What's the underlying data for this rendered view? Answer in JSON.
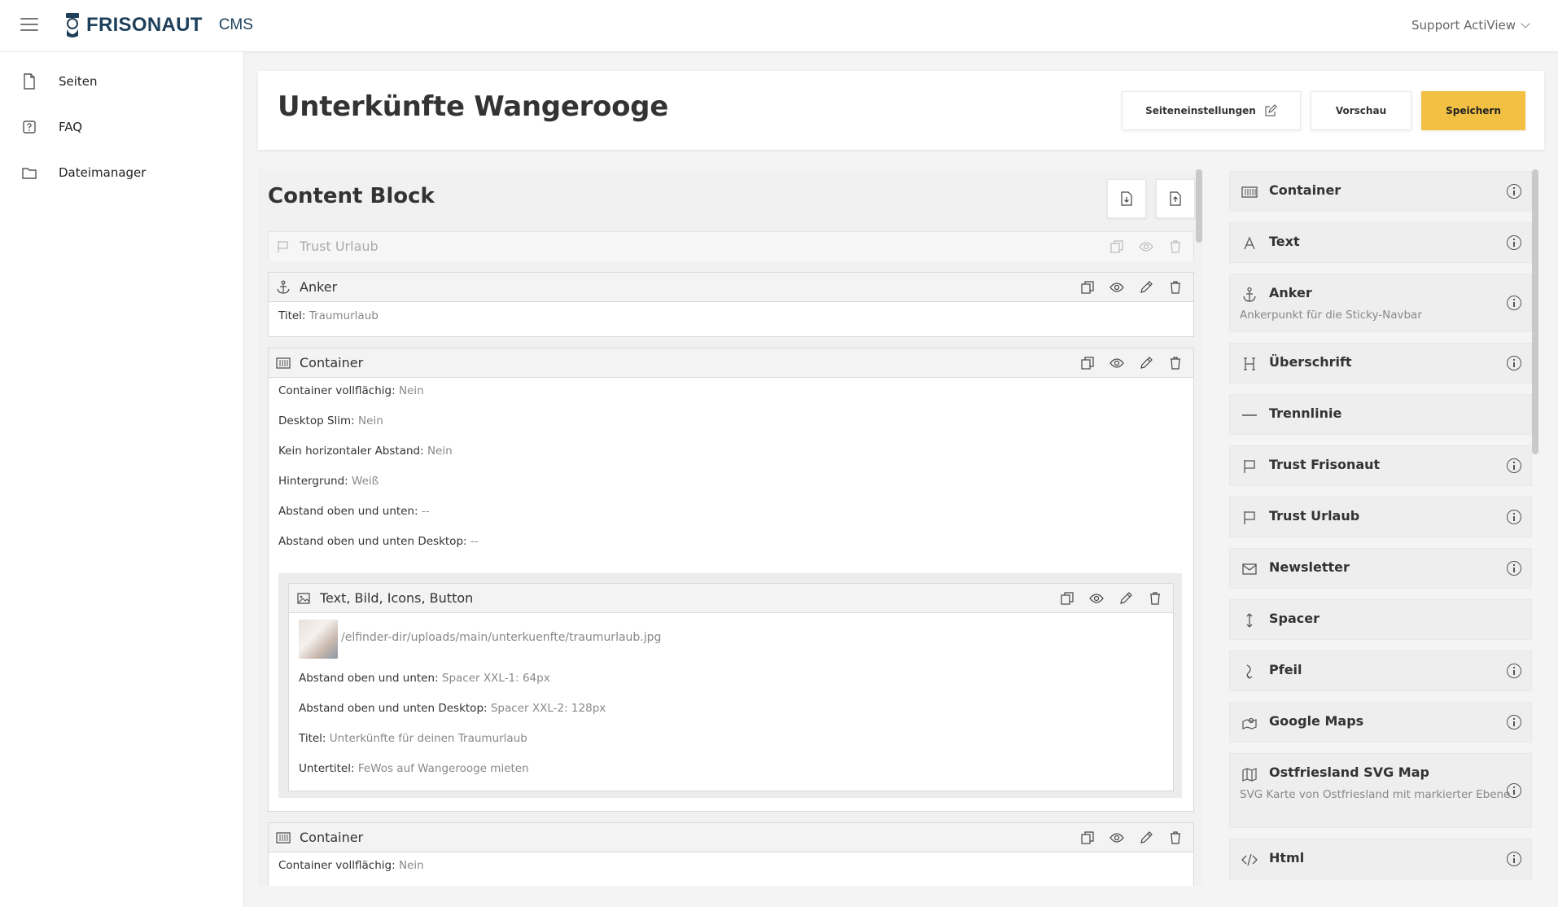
{
  "app": {
    "brand": "FRISONAUT",
    "product": "CMS",
    "user_menu": "Support ActiView"
  },
  "sidebar": {
    "items": [
      {
        "label": "Seiten",
        "icon": "file-icon"
      },
      {
        "label": "FAQ",
        "icon": "help-square-icon"
      },
      {
        "label": "Dateimanager",
        "icon": "folder-icon"
      }
    ]
  },
  "header": {
    "title": "Unterkünfte Wangerooge",
    "settings_label": "Seiteneinstellungen",
    "preview_label": "Vorschau",
    "save_label": "Speichern"
  },
  "content": {
    "title": "Content Block",
    "blocks": [
      {
        "title": "Trust Urlaub",
        "disabled": true
      },
      {
        "title": "Anker",
        "props": [
          {
            "k": "Titel:",
            "v": "Traumurlaub"
          }
        ]
      },
      {
        "title": "Container",
        "props": [
          {
            "k": "Container vollflächig:",
            "v": "Nein"
          },
          {
            "k": "Desktop Slim:",
            "v": "Nein"
          },
          {
            "k": "Kein horizontaler Abstand:",
            "v": "Nein"
          },
          {
            "k": "Hintergrund:",
            "v": "Weiß"
          },
          {
            "k": "Abstand oben und unten:",
            "v": "--"
          },
          {
            "k": "Abstand oben und unten Desktop:",
            "v": "--"
          }
        ],
        "nested": {
          "title": "Text, Bild, Icons, Button",
          "image_path": "/elfinder-dir/uploads/main/unterkuenfte/traumurlaub.jpg",
          "props": [
            {
              "k": "Abstand oben und unten:",
              "v": "Spacer XXL-1: 64px"
            },
            {
              "k": "Abstand oben und unten Desktop:",
              "v": "Spacer XXL-2: 128px"
            },
            {
              "k": "Titel:",
              "v": "Unterkünfte für deinen Traumurlaub"
            },
            {
              "k": "Untertitel:",
              "v": "FeWos auf Wangerooge mieten"
            }
          ]
        }
      },
      {
        "title": "Container",
        "props": [
          {
            "k": "Container vollflächig:",
            "v": "Nein"
          }
        ]
      }
    ]
  },
  "palette": [
    {
      "label": "Container",
      "icon": "container-icon",
      "info": true
    },
    {
      "label": "Text",
      "icon": "text-icon",
      "info": true
    },
    {
      "label": "Anker",
      "icon": "anchor-icon",
      "desc": "Ankerpunkt für die Sticky-Navbar",
      "info": true
    },
    {
      "label": "Überschrift",
      "icon": "heading-icon",
      "info": true
    },
    {
      "label": "Trennlinie",
      "icon": "divider-icon",
      "info": false
    },
    {
      "label": "Trust Frisonaut",
      "icon": "flag-icon",
      "info": true
    },
    {
      "label": "Trust Urlaub",
      "icon": "flag-icon",
      "info": true
    },
    {
      "label": "Newsletter",
      "icon": "mail-icon",
      "info": true
    },
    {
      "label": "Spacer",
      "icon": "vertical-arrows-icon",
      "info": false
    },
    {
      "label": "Pfeil",
      "icon": "arrow-icon",
      "info": true
    },
    {
      "label": "Google Maps",
      "icon": "map-pin-icon",
      "info": true
    },
    {
      "label": "Ostfriesland SVG Map",
      "icon": "map-icon",
      "desc": "SVG Karte von Ostfriesland mit markierter Ebene",
      "info": true
    },
    {
      "label": "Html",
      "icon": "code-icon",
      "info": true
    }
  ],
  "colors": {
    "primary": "#f2c043",
    "brand": "#1e3f5a"
  }
}
